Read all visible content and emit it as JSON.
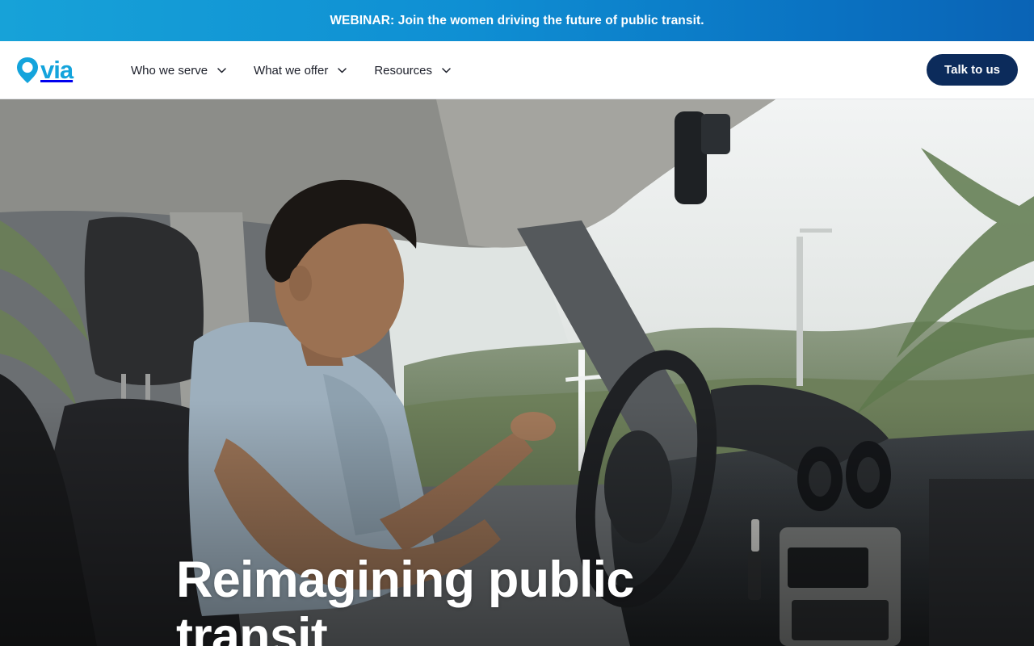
{
  "banner": {
    "text": "WEBINAR: Join the women driving the future of public transit."
  },
  "header": {
    "logo_text": "via",
    "nav": [
      {
        "label": "Who we serve",
        "icon": "chevron-down-icon"
      },
      {
        "label": "What we offer",
        "icon": "chevron-down-icon"
      },
      {
        "label": "Resources",
        "icon": "chevron-down-icon"
      }
    ],
    "cta_label": "Talk to us"
  },
  "hero": {
    "title": "Reimagining public transit"
  },
  "colors": {
    "banner_start": "#17a2d8",
    "banner_end": "#0a63b5",
    "brand": "#14a4dc",
    "cta_background": "#0c2b5b",
    "nav_text": "#1c1f2a"
  }
}
